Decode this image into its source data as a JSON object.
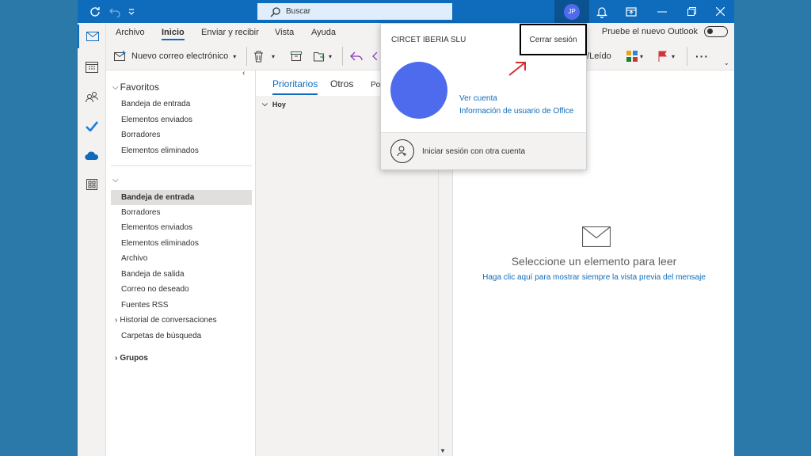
{
  "titlebar": {
    "search_placeholder": "Buscar",
    "avatar_initials": "JP"
  },
  "ribbon": {
    "tabs": [
      "Archivo",
      "Inicio",
      "Enviar y recibir",
      "Vista",
      "Ayuda"
    ],
    "new_outlook_label": "Pruebe el nuevo Outlook",
    "new_email_label": "Nuevo correo electrónico",
    "read_unread_label": "o/Leído"
  },
  "folders": {
    "favorites_header": "Favoritos",
    "favorites": [
      "Bandeja de entrada",
      "Elementos enviados",
      "Borradores",
      "Elementos eliminados"
    ],
    "account_folders": [
      "Bandeja de entrada",
      "Borradores",
      "Elementos enviados",
      "Elementos eliminados",
      "Archivo",
      "Bandeja de salida",
      "Correo no deseado",
      "Fuentes RSS"
    ],
    "history_label": "Historial de conversaciones",
    "search_folders_label": "Carpetas de búsqueda",
    "groups_label": "Grupos"
  },
  "msglist": {
    "tab_focused": "Prioritarios",
    "tab_other": "Otros",
    "tab_sort": "Po",
    "group_today": "Hoy"
  },
  "reading": {
    "empty_title": "Seleccione un elemento para leer",
    "preview_link": "Haga clic aquí para mostrar siempre la vista previa del mensaje"
  },
  "popup": {
    "org_name": "CIRCET IBERIA SLU",
    "sign_out_label": "Cerrar sesión",
    "view_account_link": "Ver cuenta",
    "office_user_info_link": "Información de usuario de Office",
    "switch_account_label": "Iniciar sesión con otra cuenta",
    "avatar_color": "#4f6bed"
  },
  "colors": {
    "brand": "#0f6cbd",
    "background": "#2b79a9",
    "annotation_arrow": "#d32f2f"
  }
}
